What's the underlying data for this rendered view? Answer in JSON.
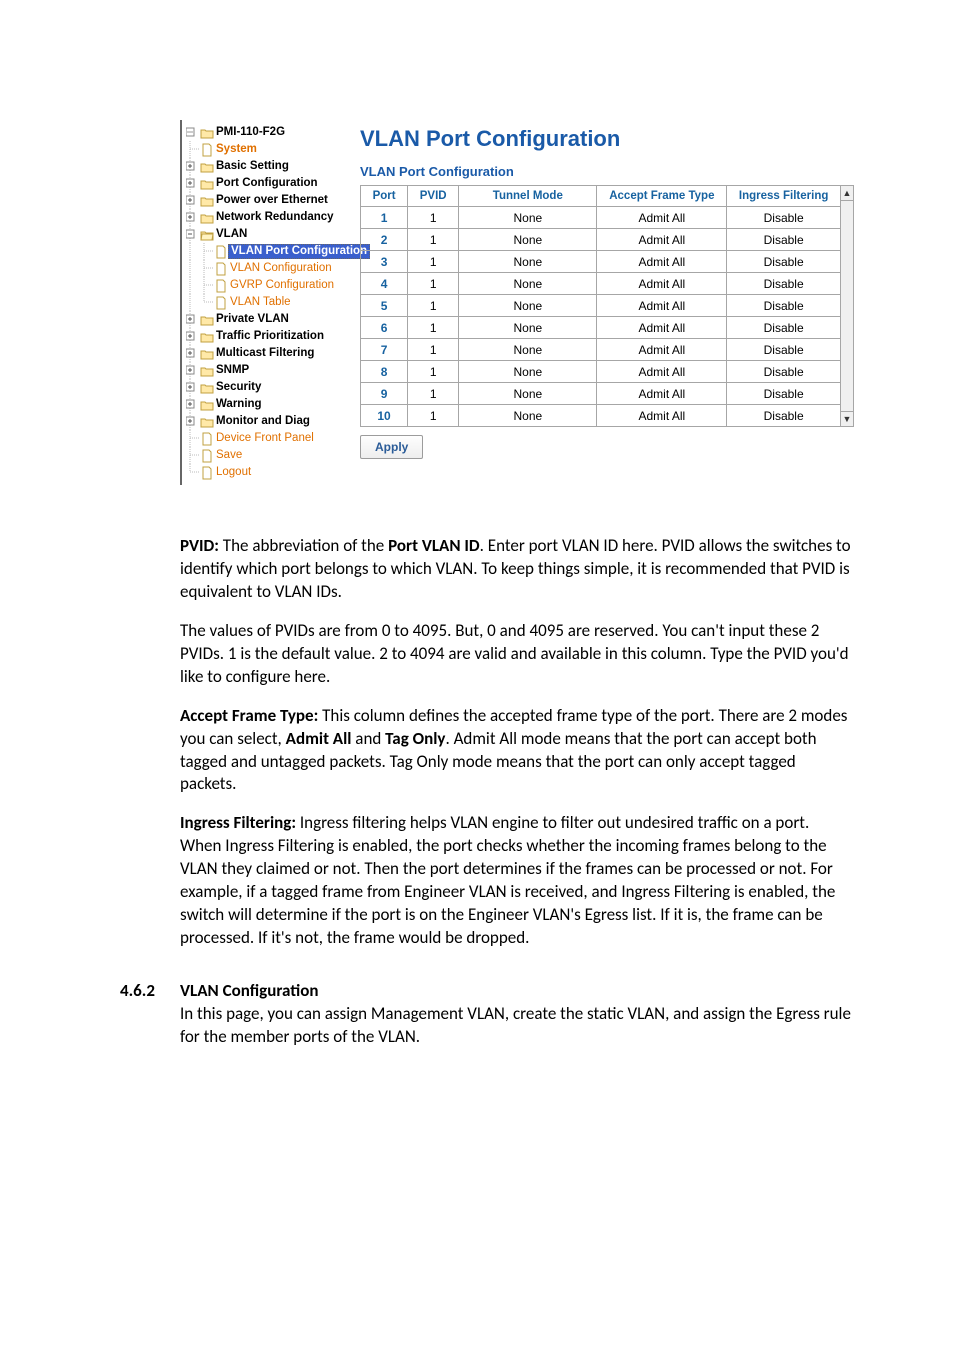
{
  "nav": {
    "root": "PMI-110-F2G",
    "system": "System",
    "basic_setting": "Basic Setting",
    "port_config": "Port Configuration",
    "poe": "Power over Ethernet",
    "net_red": "Network Redundancy",
    "vlan": "VLAN",
    "vlan_port_config": "VLAN Port Configuration",
    "vlan_config": "VLAN Configuration",
    "gvrp": "GVRP Configuration",
    "vlan_table": "VLAN Table",
    "private_vlan": "Private VLAN",
    "traffic_prio": "Traffic Prioritization",
    "multicast": "Multicast Filtering",
    "snmp": "SNMP",
    "security": "Security",
    "warning": "Warning",
    "monitor": "Monitor and Diag",
    "device_front": "Device Front Panel",
    "save": "Save",
    "logout": "Logout"
  },
  "content": {
    "title": "VLAN Port Configuration",
    "subtitle": "VLAN Port Configuration",
    "headers": {
      "port": "Port",
      "pvid": "PVID",
      "tunnel": "Tunnel Mode",
      "accept": "Accept Frame Type",
      "ingress": "Ingress Filtering"
    },
    "rows": [
      {
        "port": "1",
        "pvid": "1",
        "tunnel": "None",
        "accept": "Admit All",
        "ingress": "Disable"
      },
      {
        "port": "2",
        "pvid": "1",
        "tunnel": "None",
        "accept": "Admit All",
        "ingress": "Disable"
      },
      {
        "port": "3",
        "pvid": "1",
        "tunnel": "None",
        "accept": "Admit All",
        "ingress": "Disable"
      },
      {
        "port": "4",
        "pvid": "1",
        "tunnel": "None",
        "accept": "Admit All",
        "ingress": "Disable"
      },
      {
        "port": "5",
        "pvid": "1",
        "tunnel": "None",
        "accept": "Admit All",
        "ingress": "Disable"
      },
      {
        "port": "6",
        "pvid": "1",
        "tunnel": "None",
        "accept": "Admit All",
        "ingress": "Disable"
      },
      {
        "port": "7",
        "pvid": "1",
        "tunnel": "None",
        "accept": "Admit All",
        "ingress": "Disable"
      },
      {
        "port": "8",
        "pvid": "1",
        "tunnel": "None",
        "accept": "Admit All",
        "ingress": "Disable"
      },
      {
        "port": "9",
        "pvid": "1",
        "tunnel": "None",
        "accept": "Admit All",
        "ingress": "Disable"
      },
      {
        "port": "10",
        "pvid": "1",
        "tunnel": "None",
        "accept": "Admit All",
        "ingress": "Disable"
      }
    ],
    "apply": "Apply"
  },
  "doc": {
    "pvid_label": "PVID:",
    "pvid_mid": " The abbreviation of the ",
    "pvid_bold2": "Port VLAN ID",
    "pvid_rest": ". Enter port VLAN ID here. PVID allows the switches to identify which port belongs to which VLAN. To keep things simple, it is recommended that PVID is equivalent to VLAN IDs.",
    "pvid_p2": "The values of PVIDs are from 0 to 4095. But, 0 and 4095 are reserved. You can't input these 2 PVIDs. 1 is the default value. 2 to 4094 are valid and available in this column. Type the PVID you'd like to configure here.",
    "aft_label": "Accept Frame Type:",
    "aft_mid1": " This column defines the accepted frame type of the port. There are 2 modes you can select, ",
    "aft_b1": "Admit All",
    "aft_mid2": " and ",
    "aft_b2": "Tag Only",
    "aft_rest": ". Admit All mode means that the port can accept both tagged and untagged packets. Tag Only mode means that the port can only accept tagged packets.",
    "if_label": "Ingress Filtering:",
    "if_rest": " Ingress filtering helps VLAN engine to filter out undesired traffic on a port. When Ingress Filtering is enabled, the port checks whether the incoming frames belong to the VLAN they claimed or not. Then the port determines if the frames can be processed or not. For example, if a tagged frame from Engineer VLAN is received, and Ingress Filtering is enabled, the switch will determine if the port is on the Engineer VLAN's Egress list. If it is, the frame can be processed. If it's not, the frame would be dropped.",
    "sec_num": "4.6.2",
    "sec_title": "VLAN Configuration",
    "sec_body": "In this page, you can assign Management VLAN, create the static VLAN, and assign the Egress rule for the member ports of the VLAN."
  }
}
